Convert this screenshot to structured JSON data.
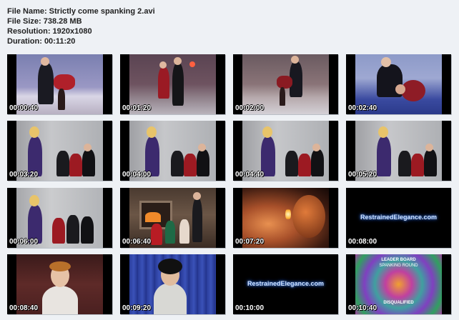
{
  "file_info": {
    "name": "File Name: Strictly come spanking 2.avi",
    "size": "File Size: 738.28 MB",
    "resolution": "Resolution: 1920x1080",
    "duration": "Duration: 00:11:20"
  },
  "thumbnails": [
    {
      "time": "00:00:40"
    },
    {
      "time": "00:01:20"
    },
    {
      "time": "00:02:00"
    },
    {
      "time": "00:02:40"
    },
    {
      "time": "00:03:20"
    },
    {
      "time": "00:04:00"
    },
    {
      "time": "00:04:40"
    },
    {
      "time": "00:05:20"
    },
    {
      "time": "00:06:00"
    },
    {
      "time": "00:06:40"
    },
    {
      "time": "00:07:20"
    },
    {
      "time": "00:08:00",
      "caption": "RestrainedElegance.com"
    },
    {
      "time": "00:08:40"
    },
    {
      "time": "00:09:20"
    },
    {
      "time": "00:10:00",
      "caption": "RestrainedElegance.com"
    },
    {
      "time": "00:10:40",
      "board_title": "LEADER BOARD",
      "board_subtitle": "SPANKING ROUND",
      "board_status": "DISQUALIFIED"
    }
  ]
}
